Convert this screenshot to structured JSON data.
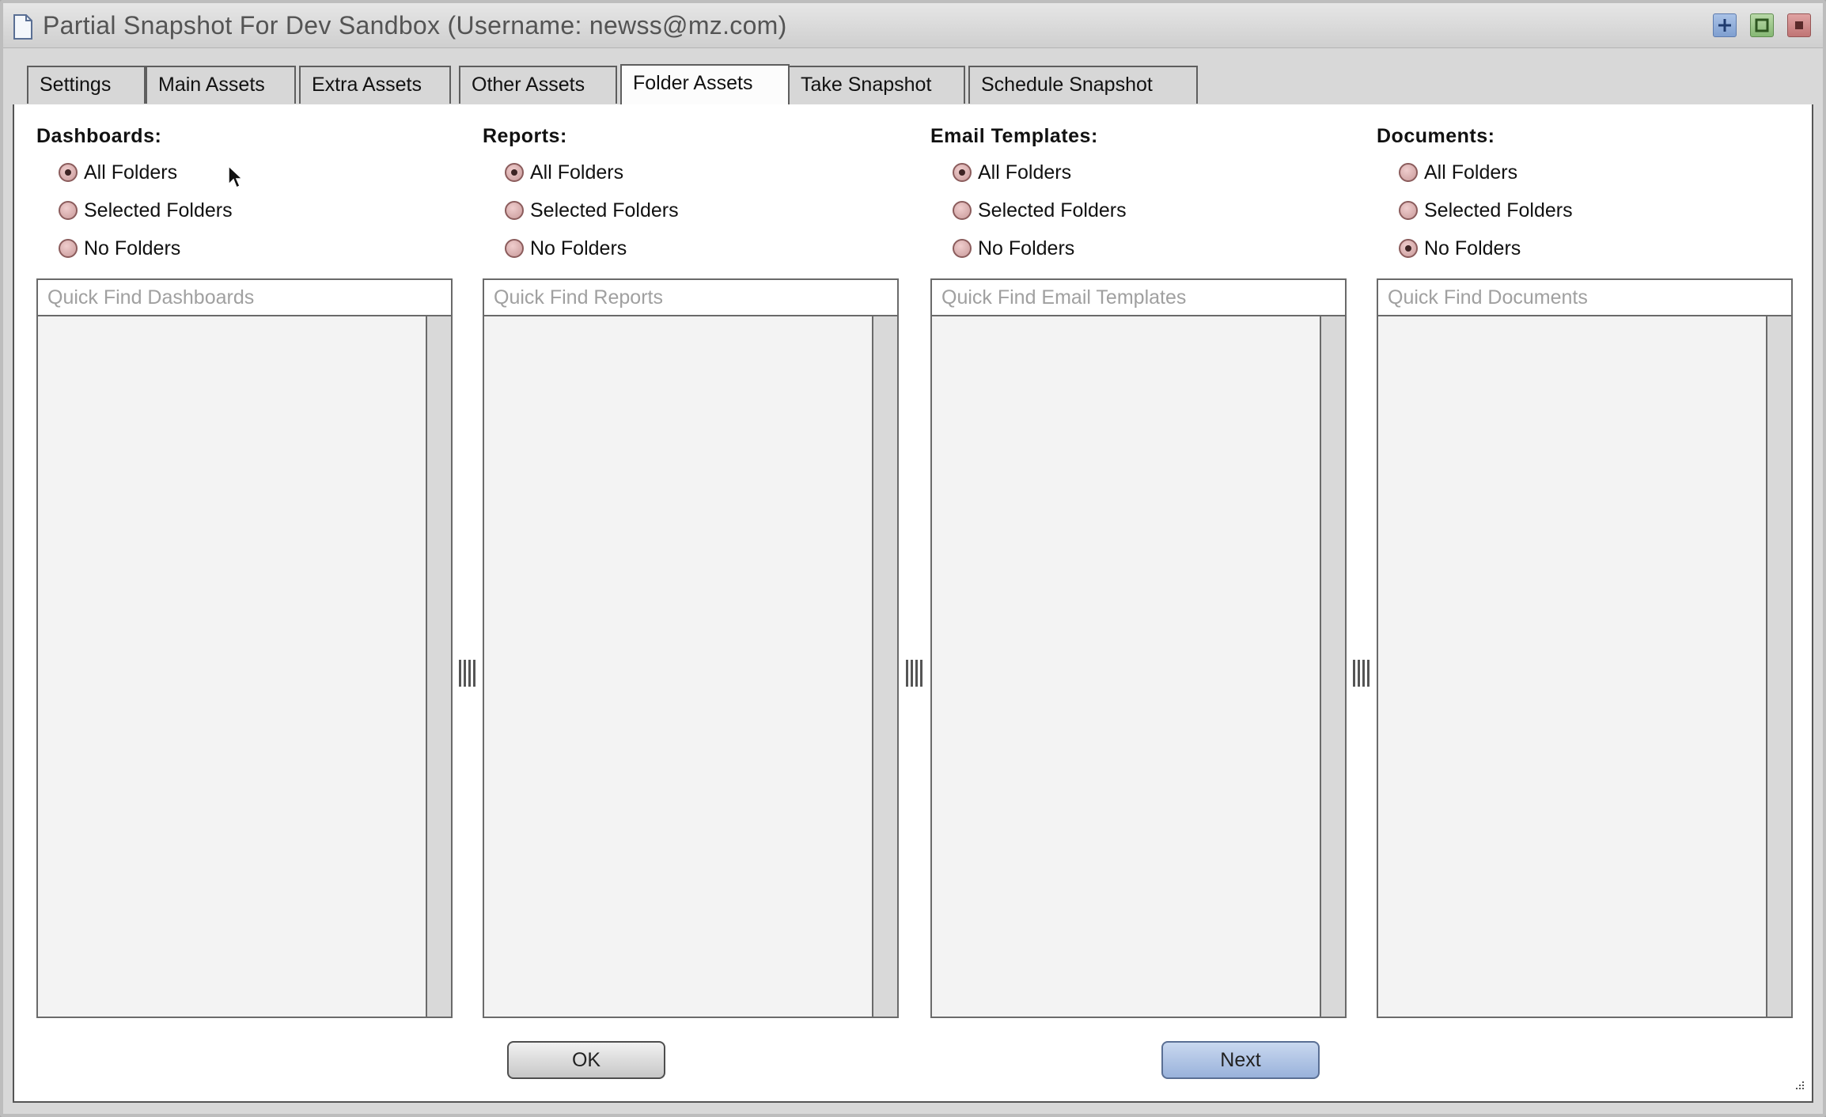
{
  "window": {
    "title": "Partial Snapshot For Dev Sandbox (Username: newss@mz.com)"
  },
  "title_buttons": {
    "add": "plus-icon",
    "maximize": "square-icon",
    "close": "close-icon"
  },
  "tabs": [
    {
      "label": "Settings",
      "active": false
    },
    {
      "label": "Main Assets",
      "active": false
    },
    {
      "label": "Extra Assets",
      "active": false
    },
    {
      "label": "Other Assets",
      "active": false
    },
    {
      "label": "Folder Assets",
      "active": true
    },
    {
      "label": "Take Snapshot",
      "active": false
    },
    {
      "label": "Schedule Snapshot",
      "active": false
    }
  ],
  "sections": [
    {
      "title": "Dashboards:",
      "options": [
        "All Folders",
        "Selected Folders",
        "No Folders"
      ],
      "selected": "All Folders",
      "search_placeholder": "Quick Find Dashboards"
    },
    {
      "title": "Reports:",
      "options": [
        "All Folders",
        "Selected Folders",
        "No Folders"
      ],
      "selected": "All Folders",
      "search_placeholder": "Quick Find Reports"
    },
    {
      "title": "Email Templates:",
      "options": [
        "All Folders",
        "Selected Folders",
        "No Folders"
      ],
      "selected": "All Folders",
      "search_placeholder": "Quick Find Email Templates"
    },
    {
      "title": "Documents:",
      "options": [
        "All Folders",
        "Selected Folders",
        "No Folders"
      ],
      "selected": "No Folders",
      "search_placeholder": "Quick Find Documents"
    }
  ],
  "buttons": {
    "ok_label": "OK",
    "next_label": "Next"
  },
  "colors": {
    "radio_fill": "#d8a8a8",
    "next_button": "#a9bfe2",
    "active_tab": "#fcfcfc"
  }
}
